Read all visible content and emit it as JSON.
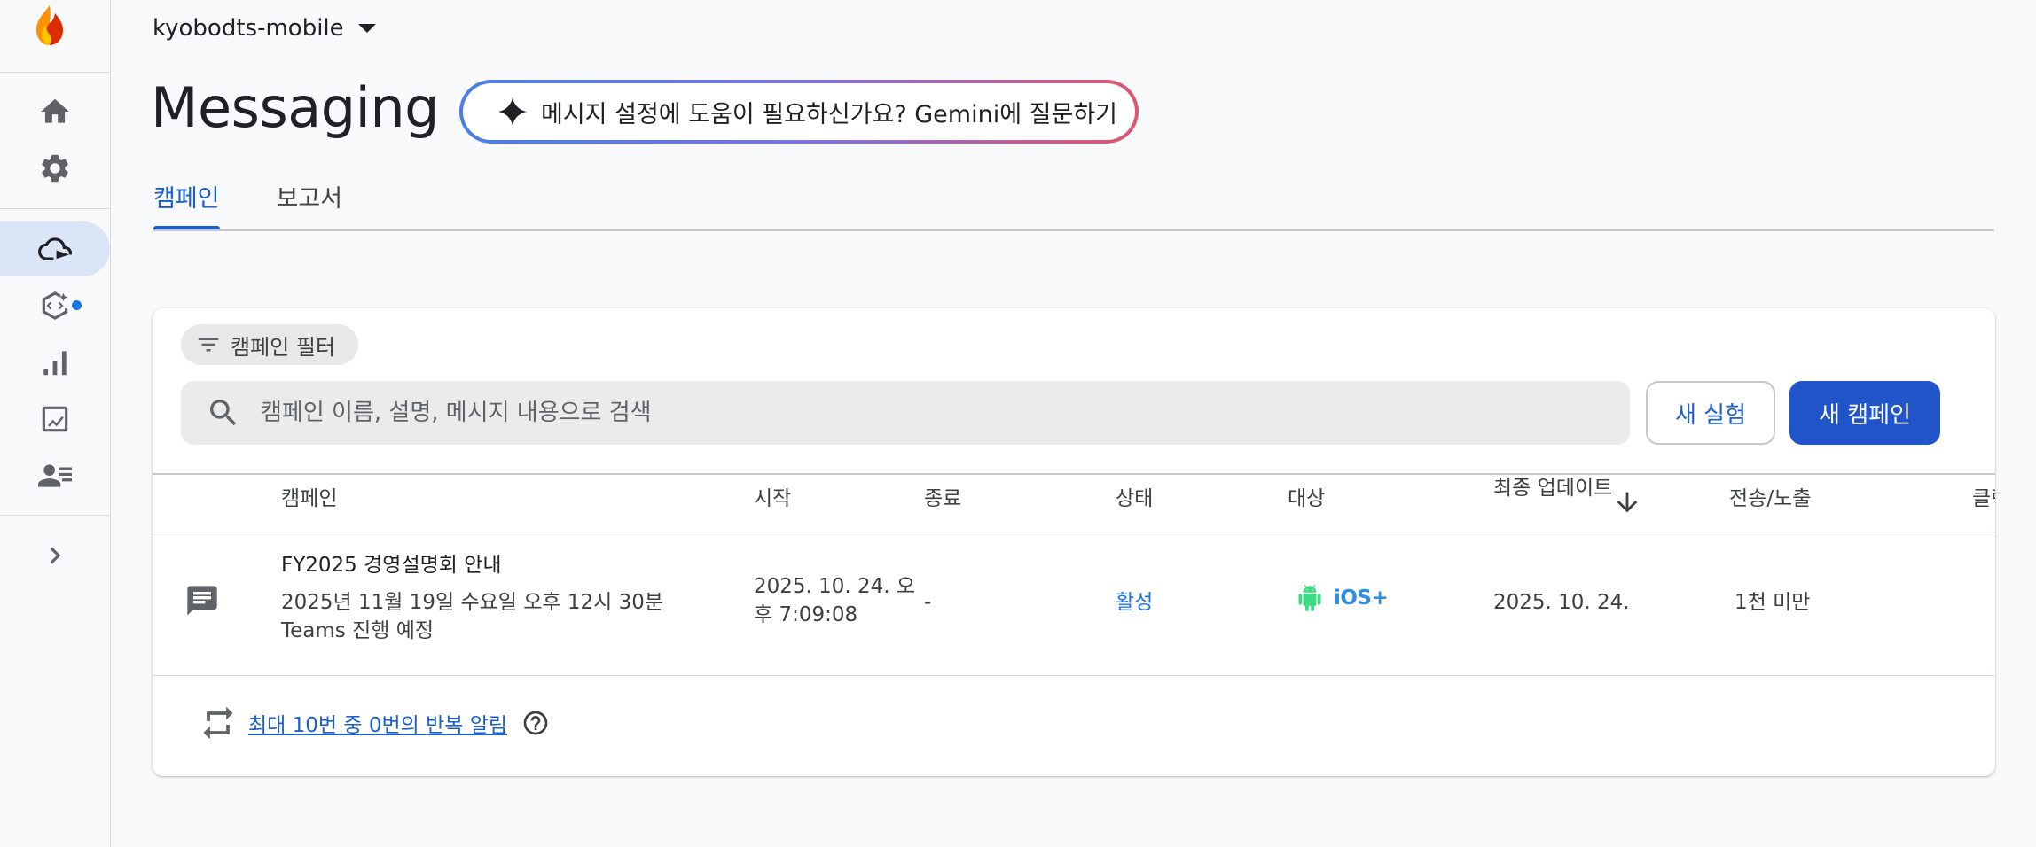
{
  "project": {
    "name": "kyobodts-mobile"
  },
  "page": {
    "title": "Messaging"
  },
  "gemini": {
    "label": "메시지 설정에 도움이 필요하신가요? Gemini에 질문하기"
  },
  "tabs": [
    {
      "label": "캠페인",
      "active": true
    },
    {
      "label": "보고서",
      "active": false
    }
  ],
  "filter": {
    "label": "캠페인 필터"
  },
  "search": {
    "placeholder": "캠페인 이름, 설명, 메시지 내용으로 검색"
  },
  "buttons": {
    "new_experiment": "새 실험",
    "new_campaign": "새 캠페인"
  },
  "table": {
    "headers": {
      "campaign": "캠페인",
      "start": "시작",
      "end": "종료",
      "status": "상태",
      "target": "대상",
      "updated": "최종 업데이트",
      "sent": "전송/노출",
      "clicks": "클릭"
    },
    "rows": [
      {
        "name": "FY2025 경영설명회 안내",
        "description": "2025년 11월 19일 수요일 오후 12시 30분 Teams 진행 예정",
        "start": "2025. 10. 24. 오후 7:09:08",
        "end": "-",
        "status": "활성",
        "target_ios": "iOS+",
        "updated": "2025. 10. 24.",
        "sent": "1천 미만"
      }
    ]
  },
  "repeat": {
    "link": "최대 10번 중 0번의 반복 알림"
  },
  "colors": {
    "primary": "#1f55c9",
    "accent": "#1a73e8",
    "active_nav": "#dbe5f8"
  }
}
